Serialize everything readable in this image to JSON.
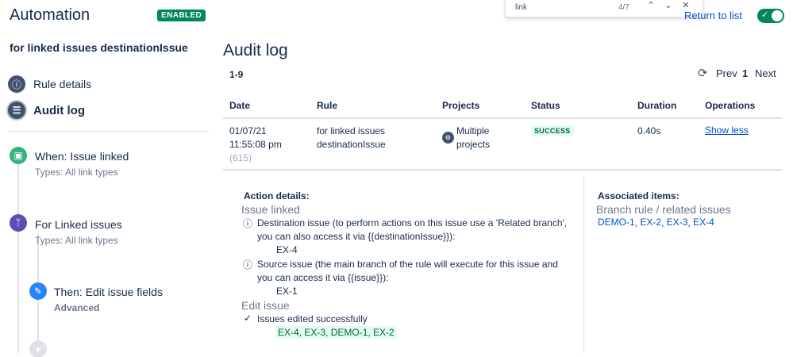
{
  "sidebar": {
    "app_title": "Automation",
    "enabled_badge": "ENABLED",
    "rule_name": "for linked issues destinationIssue",
    "nav": [
      {
        "label": "Rule details"
      },
      {
        "label": "Audit log"
      }
    ],
    "chain": [
      {
        "title": "When: Issue linked",
        "sub": "Types: All link types"
      },
      {
        "title": "For Linked issues",
        "sub": "Types: All link types"
      },
      {
        "title": "Then: Edit issue fields",
        "sub": "Advanced"
      }
    ]
  },
  "find_bar": {
    "query": "link",
    "count": "4/7"
  },
  "header": {
    "return_link": "Return to list"
  },
  "main": {
    "title": "Audit log",
    "range": "1-9",
    "pager": {
      "prev": "Prev",
      "page": "1",
      "next": "Next"
    },
    "columns": [
      "Date",
      "Rule",
      "Projects",
      "Status",
      "Duration",
      "Operations"
    ],
    "row": {
      "date_line1": "01/07/21",
      "date_line2": "11:55:08 pm",
      "id": "(615)",
      "rule_line1": "for linked issues",
      "rule_line2": "destinationIssue",
      "projects_line1": "Multiple",
      "projects_line2": "projects",
      "status": "SUCCESS",
      "duration": "0.40s",
      "operation": "Show less"
    },
    "action_details": {
      "heading": "Action details:",
      "issue_linked_label": "Issue linked",
      "dest_line1": "Destination issue (to perform actions on this issue use a 'Related branch',",
      "dest_line2": "you can also access it via {{destinationIssue}}):",
      "dest_key": "EX-4",
      "source_line1": "Source issue (the main branch of the rule will execute for this issue and",
      "source_line2": "you can access it via {{issue}}):",
      "source_key": "EX-1",
      "edit_issue_label": "Edit issue",
      "edited_text": "Issues edited successfully",
      "edited_keys": "EX-4, EX-3, DEMO-1, EX-2"
    },
    "associated": {
      "heading": "Associated items:",
      "sub": "Branch rule / related issues",
      "links": [
        "DEMO-1",
        "EX-2",
        "EX-3",
        "EX-4"
      ]
    }
  },
  "colors": {
    "accent": "#0052cc",
    "success": "#00875a",
    "success_bg": "#e3fcef"
  }
}
